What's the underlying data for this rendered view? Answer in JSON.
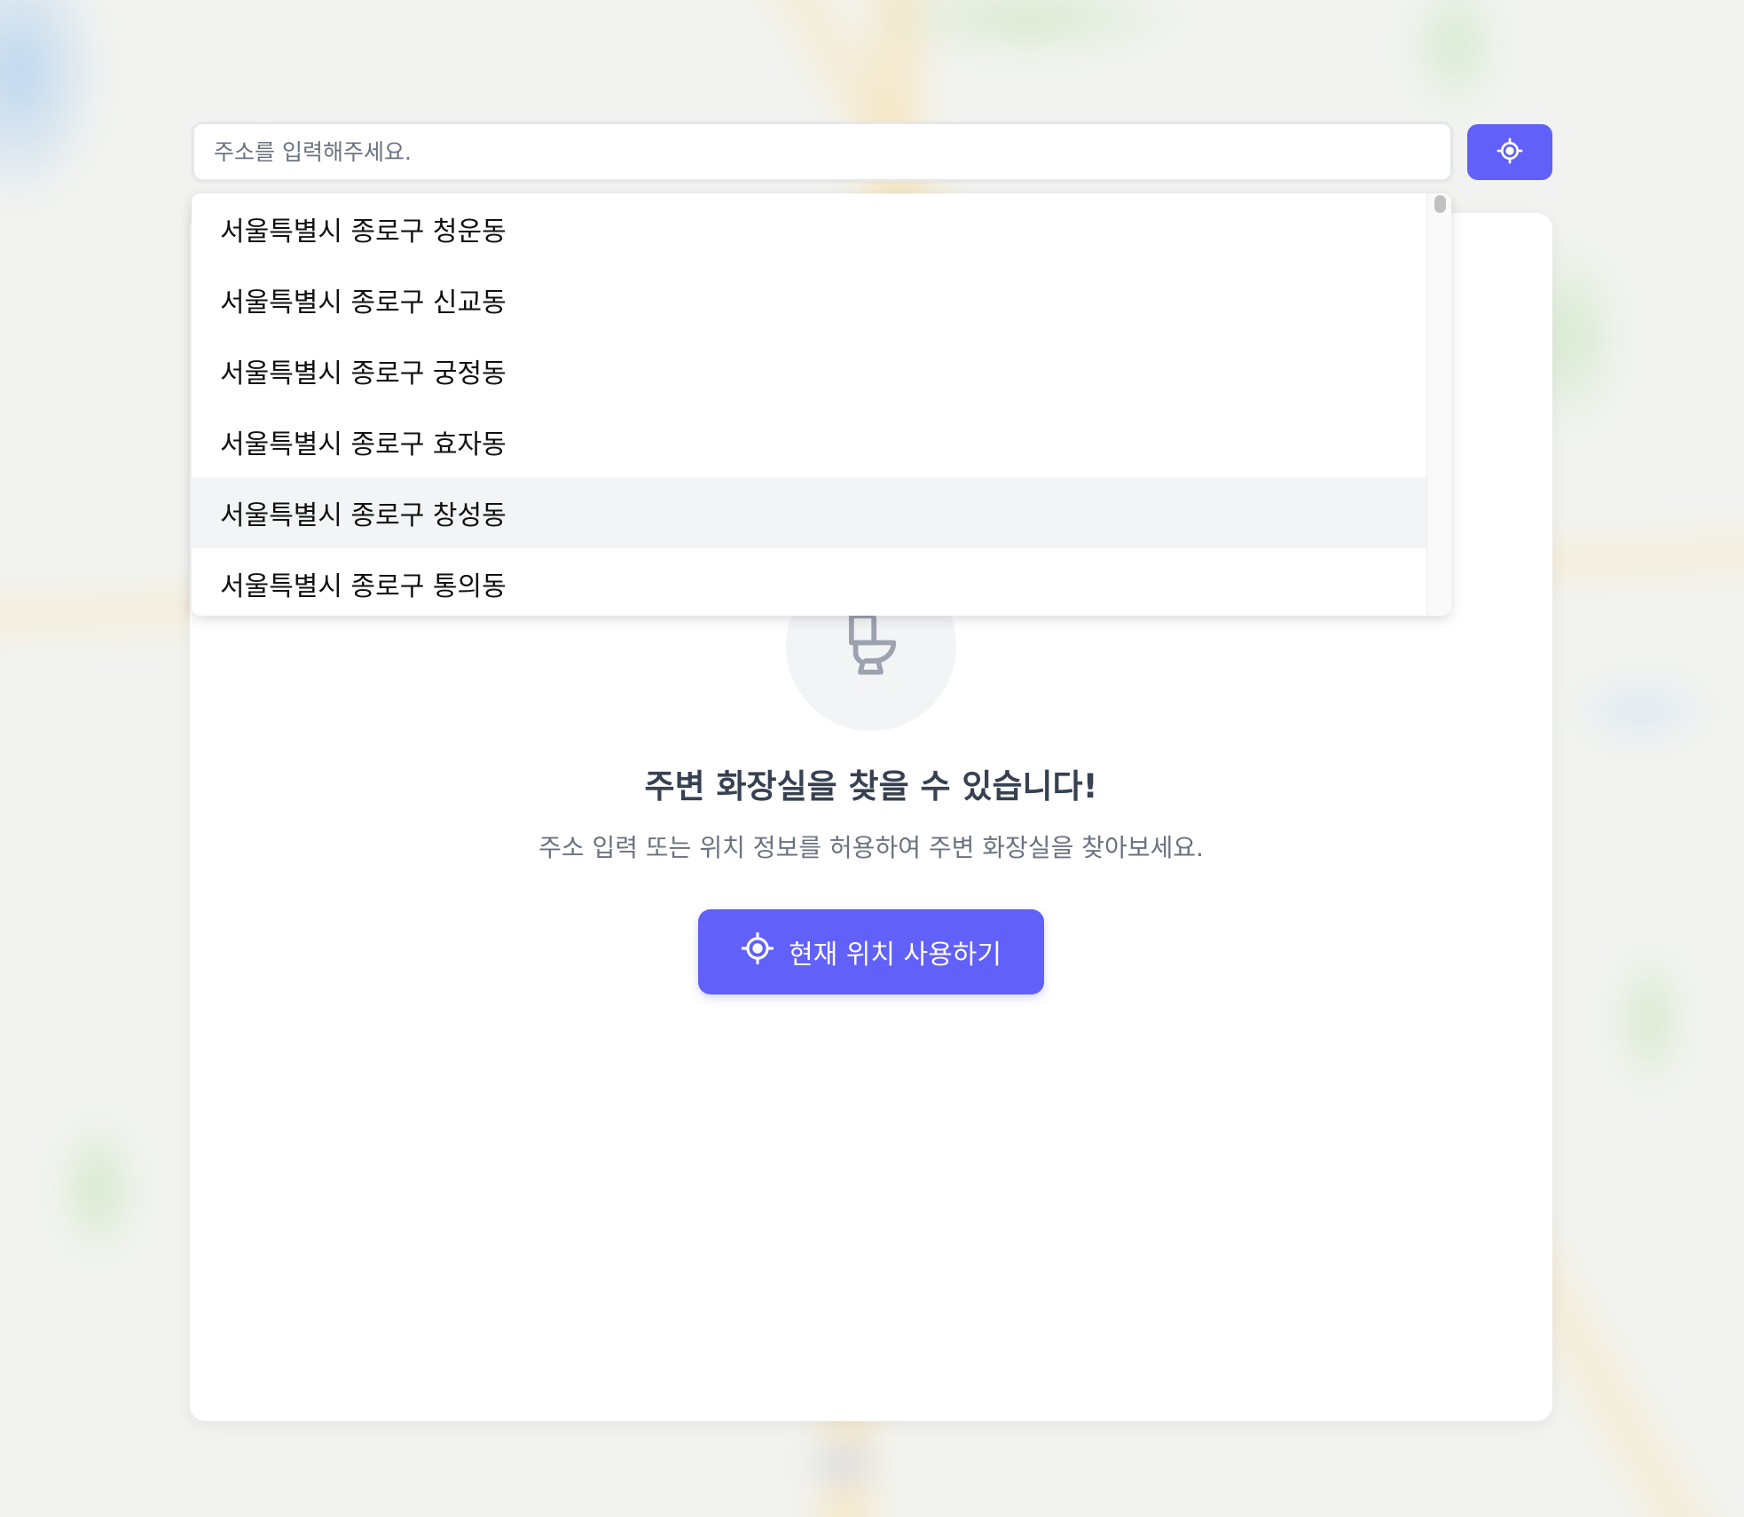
{
  "search": {
    "placeholder": "주소를 입력해주세요.",
    "value": ""
  },
  "suggestions": [
    "서울특별시 종로구 청운동",
    "서울특별시 종로구 신교동",
    "서울특별시 종로구 궁정동",
    "서울특별시 종로구 효자동",
    "서울특별시 종로구 창성동",
    "서울특별시 종로구 통의동"
  ],
  "highlighted_suggestion_index": 4,
  "empty_state": {
    "icon": "toilet-icon",
    "title": "주변 화장실을 찾을 수 있습니다!",
    "description": "주소 입력 또는 위치 정보를 허용하여 주변 화장실을 찾아보세요.",
    "button_label": "현재 위치 사용하기",
    "button_icon": "crosshair-icon"
  },
  "colors": {
    "accent": "#6160f8",
    "title_text": "#374151",
    "muted_text": "#6b7280"
  }
}
